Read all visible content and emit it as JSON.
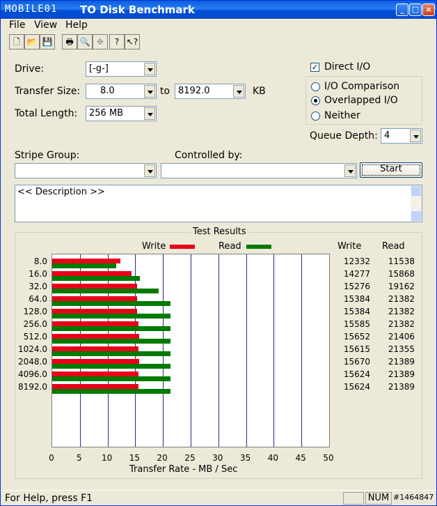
{
  "window": {
    "logo_text": "MOBILE01",
    "title": "TO Disk Benchmark"
  },
  "menu": {
    "file": "File",
    "view": "View",
    "help": "Help"
  },
  "toolbar": {
    "icons": [
      "new-icon",
      "open-icon",
      "save-icon",
      "print-icon",
      "print-preview-icon",
      "move-icon",
      "help-icon",
      "context-help-icon"
    ]
  },
  "form": {
    "drive_label": "Drive:",
    "drive_value": "[-g-]",
    "transfer_size_label": "Transfer Size:",
    "transfer_from": "8.0",
    "to_label": "to",
    "transfer_to": "8192.0",
    "kb_label": "KB",
    "total_length_label": "Total Length:",
    "total_length_value": "256 MB",
    "direct_io_label": "Direct I/O",
    "io_comparison_label": "I/O Comparison",
    "overlapped_io_label": "Overlapped I/O",
    "neither_label": "Neither",
    "queue_depth_label": "Queue Depth:",
    "queue_depth_value": "4",
    "stripe_group_label": "Stripe Group:",
    "controlled_by_label": "Controlled by:",
    "start_button": "Start",
    "description": "<< Description >>"
  },
  "results": {
    "title": "Test Results",
    "write_legend": "Write",
    "read_legend": "Read",
    "write_col": "Write",
    "read_col": "Read"
  },
  "chart_data": {
    "type": "bar",
    "orientation": "horizontal",
    "categories": [
      "8.0",
      "16.0",
      "32.0",
      "64.0",
      "128.0",
      "256.0",
      "512.0",
      "1024.0",
      "2048.0",
      "4096.0",
      "8192.0"
    ],
    "series": [
      {
        "name": "Write",
        "values": [
          12332,
          14277,
          15276,
          15384,
          15384,
          15585,
          15652,
          15615,
          15670,
          15624,
          15624
        ],
        "color": "#e8001a"
      },
      {
        "name": "Read",
        "values": [
          11538,
          15868,
          19162,
          21382,
          21382,
          21382,
          21406,
          21355,
          21389,
          21389,
          21389
        ],
        "color": "#007a00"
      }
    ],
    "xlabel": "Transfer Rate - MB / Sec",
    "xlim": [
      0,
      50
    ],
    "xticks": [
      "0",
      "5",
      "10",
      "15",
      "20",
      "25",
      "30",
      "35",
      "40",
      "45",
      "50"
    ],
    "grid": true,
    "legend": "top"
  },
  "status": {
    "help_text": "For Help, press F1",
    "num": "NUM",
    "watermark": "#1464847"
  }
}
